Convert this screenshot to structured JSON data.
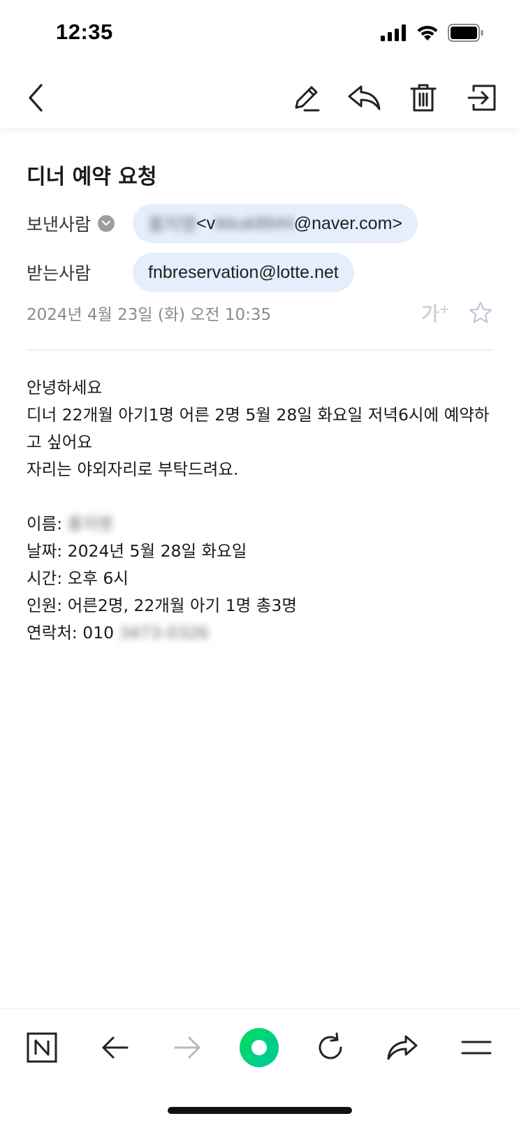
{
  "status_bar": {
    "time": "12:35"
  },
  "toolbar": {
    "back_icon": "chevron-left-icon",
    "edit_icon": "pencil-icon",
    "reply_icon": "reply-icon",
    "delete_icon": "trash-icon",
    "move_icon": "move-to-folder-icon"
  },
  "mail": {
    "subject": "디너 예약 요청",
    "sender_label": "보낸사람",
    "sender_name": "홍지영",
    "sender_email_prefix": " <v",
    "sender_email_hidden": "ikkuk8844",
    "sender_email_suffix": "@naver.com>",
    "recipient_label": "받는사람",
    "recipient_email": "fnbreservation@lotte.net",
    "date": "2024년 4월 23일 (화) 오전 10:35",
    "font_size_label": "가",
    "font_size_plus": "+",
    "body_lines": [
      "안녕하세요",
      "디너 22개월 아기1명 어른 2명 5월 28일 화요일 저녁6시에 예약하",
      "고 싶어요",
      "자리는 야외자리로 부탁드려요.",
      ""
    ],
    "name_label": "이름: ",
    "name_value": "홍지영",
    "date_line": "날짜: 2024년 5월 28일 화요일",
    "time_line": "시간: 오후 6시",
    "people_line": "인원: 어른2명, 22개월 아기 1명 총3명",
    "contact_label": "연락처: 010 ",
    "contact_hidden": "3473-0326"
  },
  "colors": {
    "pill_bg": "#e6eefb",
    "naver_green": "#03c75a",
    "muted_text": "#8a8a8a"
  }
}
